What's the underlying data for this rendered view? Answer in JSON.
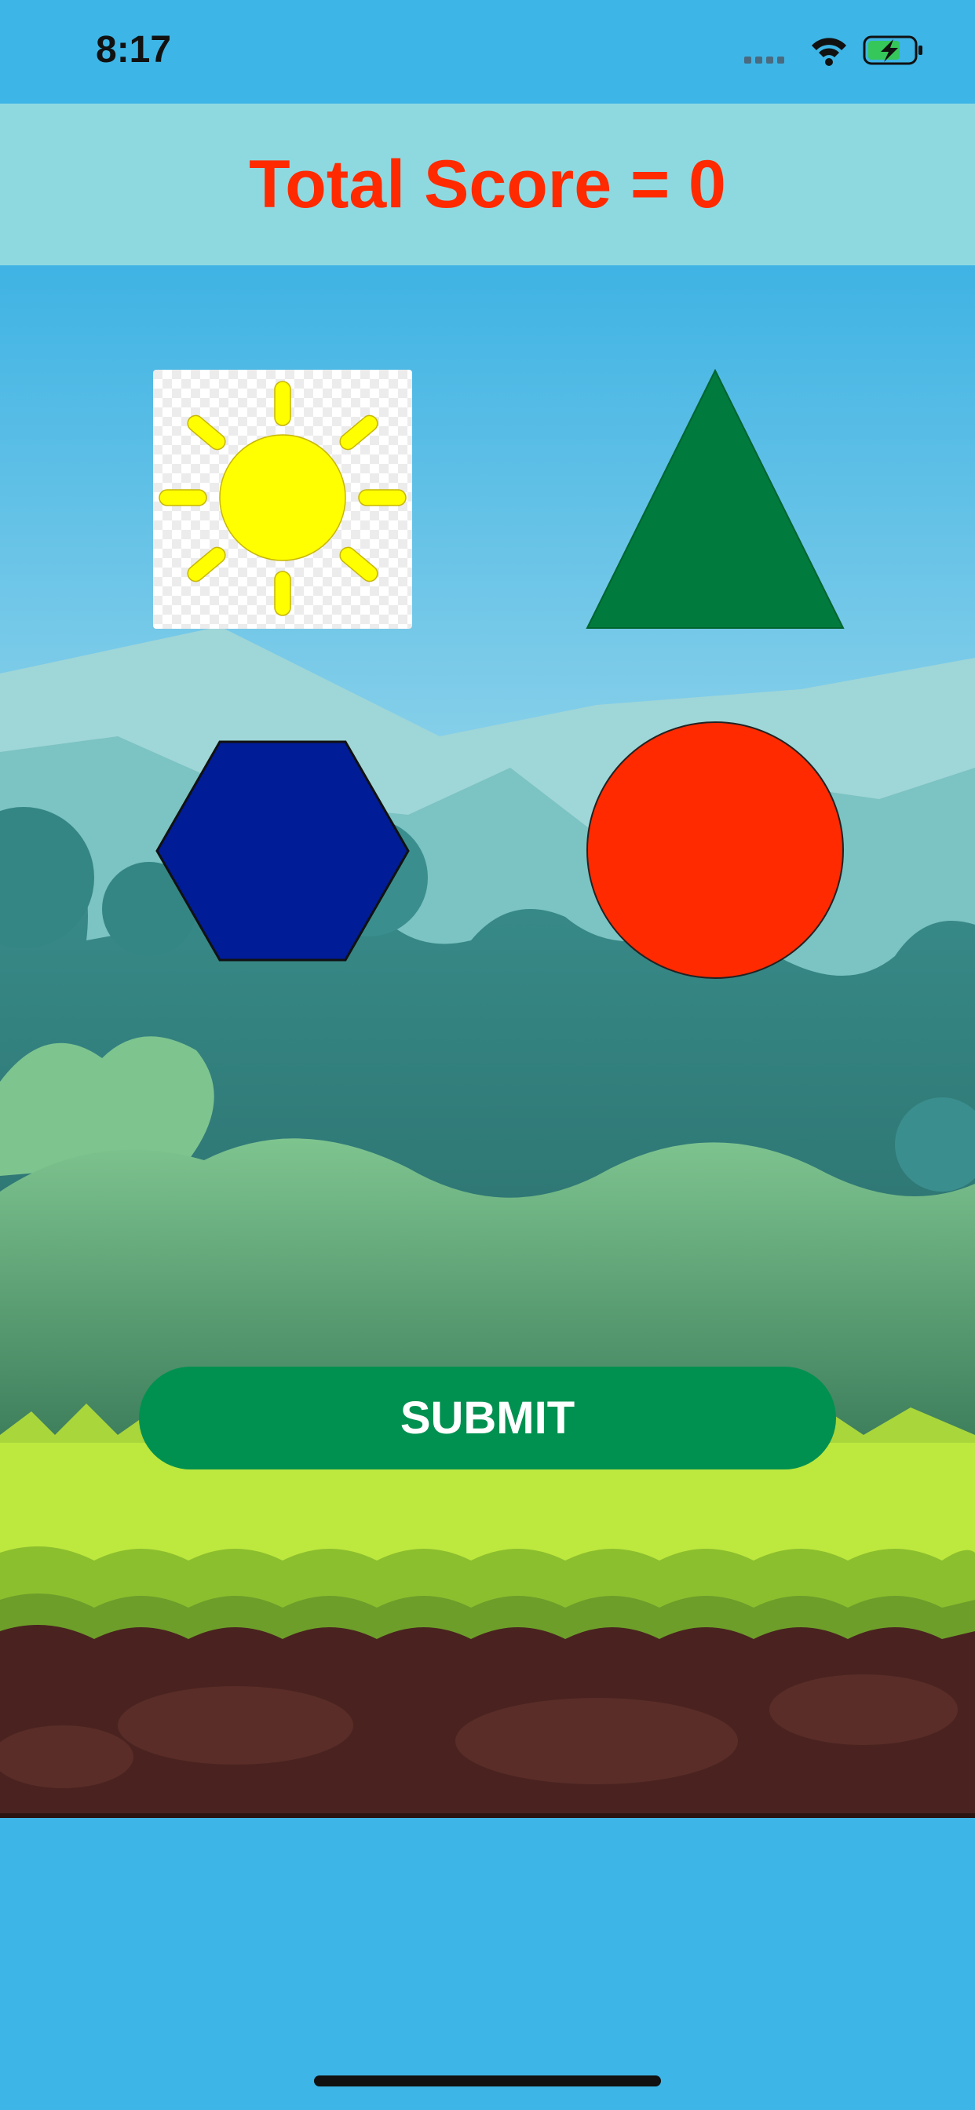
{
  "status_bar": {
    "time": "8:17",
    "icons": [
      "signal-icon",
      "wifi-icon",
      "battery-charging-icon"
    ]
  },
  "header": {
    "score_text": "Total Score = 0",
    "score_color": "#ff2a00",
    "background": "#8ed9e0"
  },
  "shapes": [
    {
      "name": "sun",
      "color": "#ffff00"
    },
    {
      "name": "triangle",
      "color": "#007a3d"
    },
    {
      "name": "hexagon",
      "color": "#001c96"
    },
    {
      "name": "circle",
      "color": "#ff2a00"
    }
  ],
  "submit": {
    "label": "SUBMIT",
    "color": "#009150"
  },
  "colors": {
    "sky": "#3db5e6",
    "grass": "#bde83e",
    "soil": "#4a2320"
  }
}
